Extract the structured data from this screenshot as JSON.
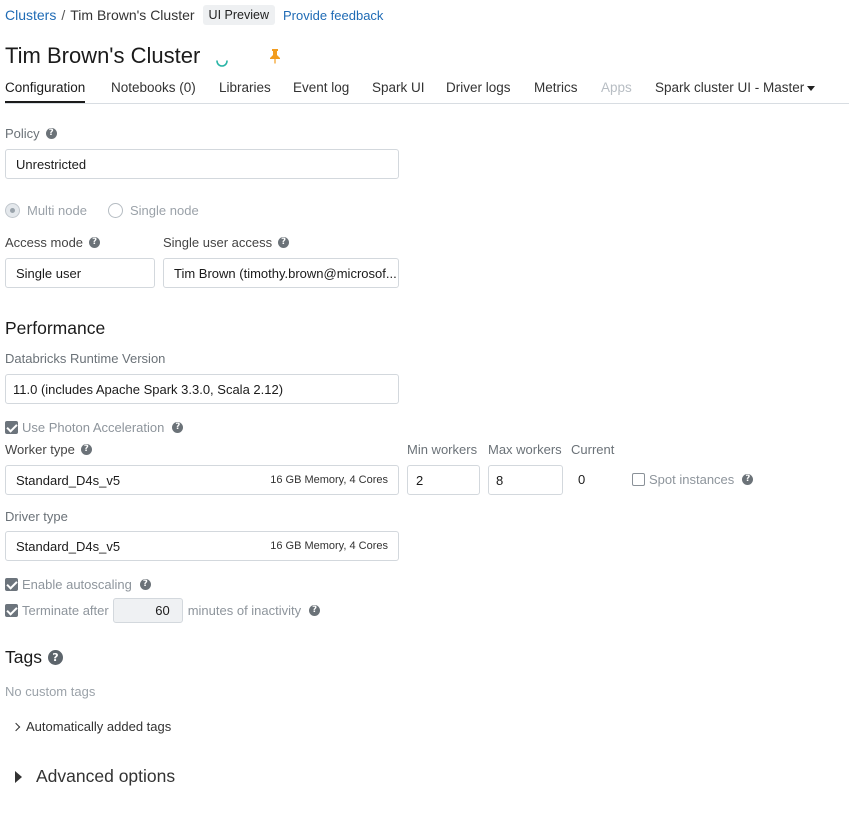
{
  "breadcrumb": {
    "root": "Clusters",
    "separator": "/",
    "current": "Tim Brown's Cluster",
    "badge": "UI Preview",
    "feedback": "Provide feedback"
  },
  "page": {
    "title": "Tim Brown's Cluster",
    "status_icon": "spinner-icon",
    "pin_icon": "pin-icon"
  },
  "tabs": [
    {
      "label": "Configuration",
      "active": true
    },
    {
      "label": "Notebooks (0)"
    },
    {
      "label": "Libraries"
    },
    {
      "label": "Event log"
    },
    {
      "label": "Spark UI"
    },
    {
      "label": "Driver logs"
    },
    {
      "label": "Metrics"
    },
    {
      "label": "Apps",
      "disabled": true
    },
    {
      "label": "Spark cluster UI - Master",
      "dropdown": true
    }
  ],
  "policy": {
    "label": "Policy",
    "value": "Unrestricted"
  },
  "node_mode": {
    "multi": "Multi node",
    "single": "Single node",
    "selected": "Multi node"
  },
  "access": {
    "mode_label": "Access mode",
    "mode_value": "Single user",
    "user_label": "Single user access",
    "user_value": "Tim Brown (timothy.brown@microsof..."
  },
  "performance": {
    "title": "Performance",
    "runtime_label": "Databricks Runtime Version",
    "runtime_value": "11.0 (includes Apache Spark 3.3.0, Scala 2.12)",
    "photon_label": "Use Photon Acceleration",
    "photon_checked": true
  },
  "workers": {
    "worker_type_label": "Worker type",
    "worker_type_value": "Standard_D4s_v5",
    "worker_type_meta": "16 GB Memory, 4 Cores",
    "min_label": "Min workers",
    "min_value": "2",
    "max_label": "Max workers",
    "max_value": "8",
    "current_label": "Current",
    "current_value": "0",
    "spot_label": "Spot instances",
    "spot_checked": false
  },
  "driver": {
    "label": "Driver type",
    "value": "Standard_D4s_v5",
    "meta": "16 GB Memory, 4 Cores"
  },
  "autoscaling": {
    "label": "Enable autoscaling",
    "checked": true
  },
  "terminate": {
    "label": "Terminate after",
    "value": "60",
    "suffix": "minutes of inactivity",
    "checked": true
  },
  "tags": {
    "title": "Tags",
    "empty": "No custom tags",
    "auto_label": "Automatically added tags"
  },
  "advanced": {
    "label": "Advanced options"
  },
  "colors": {
    "link": "#1f6bb5",
    "pin": "#f29c1f",
    "spinner": "#2bb5a7"
  }
}
